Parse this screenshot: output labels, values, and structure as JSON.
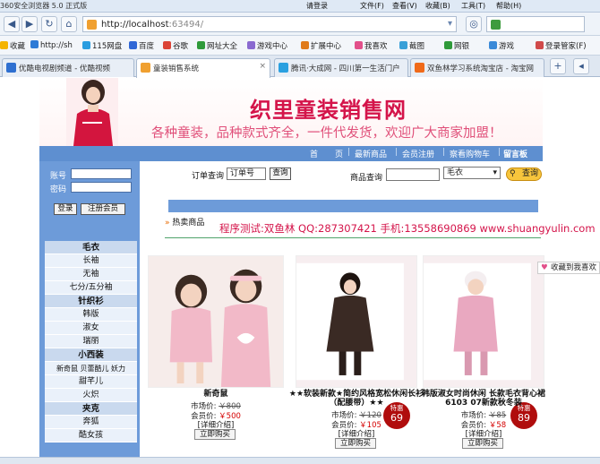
{
  "browser": {
    "title": "360安全浏览器 5.0 正式版",
    "login": "请登录",
    "menus": [
      "文件(F)",
      "查看(V)",
      "收藏(B)",
      "工具(T)",
      "帮助(H)"
    ],
    "url_host": "http://localhost",
    "url_port": ":63494/",
    "bookmarks": [
      "收藏",
      "http://sh",
      "115网盘",
      "百度",
      "谷歌",
      "网址大全",
      "游戏中心",
      "扩展中心",
      "我喜欢",
      "截图",
      "网银",
      "游戏",
      "登录管家(F)"
    ],
    "tabs": [
      "优酷电视剧频道 - 优酷视频",
      "童装销售系统",
      "腾讯·大成网 - 四川第一生活门户",
      "双鱼林学习系统淘宝店 - 淘宝网"
    ]
  },
  "site": {
    "title": "织里童装销售网",
    "slogan": "各种童装，品种款式齐全，一件代发货，欢迎广大商家加盟！",
    "nav": [
      "首",
      "页",
      "最新商品",
      "会员注册",
      "察看购物车",
      "留言板"
    ],
    "login_user_label": "账号",
    "login_pwd_label": "密码",
    "login_button": "登录",
    "register_button": "注册会员",
    "order_query_label": "订单查询",
    "order_no_value": "订单号",
    "query_button": "查询",
    "product_query_label": "商品查询",
    "category_select_value": "毛衣",
    "search_button": "查询",
    "hot_label": "热卖商品",
    "contact": "程序测试:双鱼林 QQ:287307421 手机:13558690869 www.shuangyulin.com",
    "favorite": "收藏到我喜欢"
  },
  "categories": [
    {
      "head": "毛衣",
      "items": [
        "长袖",
        "无袖",
        "七分/五分袖"
      ]
    },
    {
      "head": "针织衫",
      "items": [
        "韩版",
        "淑女",
        "瑞丽"
      ]
    },
    {
      "head": "小西装",
      "items": [
        "新奇鼠 贝蕾酷儿 妖力",
        "甜芊儿",
        "火炽"
      ]
    },
    {
      "head": "夹克",
      "items": [
        "奔狐",
        "酷女孩"
      ]
    }
  ],
  "products": [
    {
      "name": "新奇鼠",
      "market_label": "市场价:",
      "market_price": "￥800",
      "member_label": "会员价:",
      "member_price": "￥500",
      "detail": "[详细介绍]",
      "buy": "立即购买",
      "badge": null
    },
    {
      "name": "★★软装新款★简约风格宽松休闲长衫（配腰带）★★",
      "market_label": "市场价:",
      "market_price": "￥120",
      "member_label": "会员价:",
      "member_price": "￥105",
      "detail": "[详细介绍]",
      "buy": "立即购买",
      "badge": {
        "label": "特惠",
        "price": "69"
      }
    },
    {
      "name": "韩版淑女时尚休闲 长款毛衣背心裙6103 07新款秋冬装",
      "market_label": "市场价:",
      "market_price": "￥85",
      "member_label": "会员价:",
      "member_price": "￥58",
      "detail": "[详细介绍]",
      "buy": "立即购买",
      "badge": {
        "label": "特惠",
        "price": "89"
      }
    }
  ],
  "colors": {
    "brand_red": "#d4144a",
    "nav_blue": "#5e8fd0",
    "panel_blue": "#6d9bd9"
  }
}
